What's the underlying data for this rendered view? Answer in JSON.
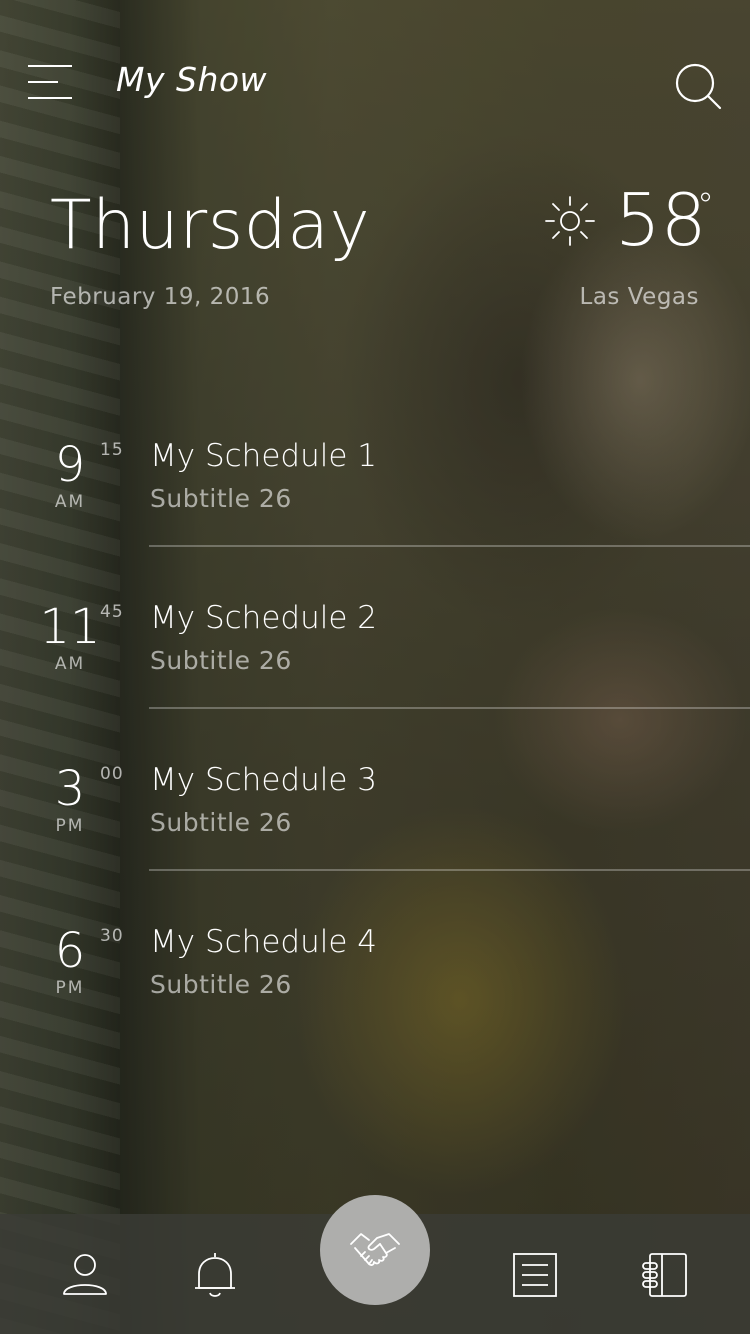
{
  "header": {
    "title": "My Show"
  },
  "day": {
    "name": "Thursday",
    "date": "February 19, 2016"
  },
  "weather": {
    "temperature": "58",
    "degree_symbol": "°",
    "city": "Las Vegas",
    "icon": "sun-icon"
  },
  "schedule": [
    {
      "hour": "9",
      "minute": "15",
      "ampm": "AM",
      "title": "My Schedule 1",
      "subtitle": "Subtitle 26"
    },
    {
      "hour": "11",
      "minute": "45",
      "ampm": "AM",
      "title": "My Schedule 2",
      "subtitle": "Subtitle 26"
    },
    {
      "hour": "3",
      "minute": "00",
      "ampm": "PM",
      "title": "My Schedule 3",
      "subtitle": "Subtitle 26"
    },
    {
      "hour": "6",
      "minute": "30",
      "ampm": "PM",
      "title": "My Schedule 4",
      "subtitle": "Subtitle 26"
    }
  ],
  "tabbar": {
    "items": [
      "profile-icon",
      "bell-icon",
      "handshake-icon",
      "list-icon",
      "book-icon"
    ]
  },
  "colors": {
    "fab": "#aeaeac",
    "text": "#ffffff",
    "tabbar": "#3a3c36"
  }
}
